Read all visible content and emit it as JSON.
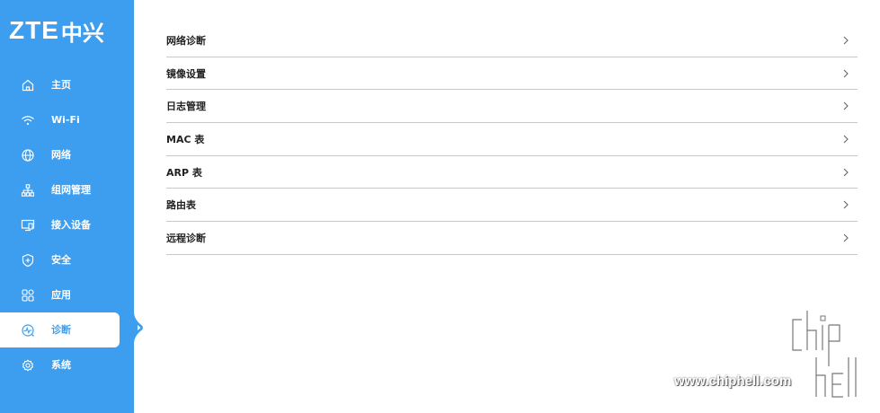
{
  "brand": {
    "latin": "ZTE",
    "cjk": "中兴"
  },
  "sidebar": {
    "items": [
      {
        "label": "主页",
        "icon": "home-icon"
      },
      {
        "label": "Wi-Fi",
        "icon": "wifi-icon"
      },
      {
        "label": "网络",
        "icon": "globe-icon"
      },
      {
        "label": "组网管理",
        "icon": "network-topology-icon"
      },
      {
        "label": "接入设备",
        "icon": "monitor-icon"
      },
      {
        "label": "安全",
        "icon": "shield-icon"
      },
      {
        "label": "应用",
        "icon": "apps-grid-icon"
      },
      {
        "label": "诊断",
        "icon": "diagnose-icon",
        "active": true
      },
      {
        "label": "系统",
        "icon": "gear-icon"
      }
    ]
  },
  "menu": {
    "items": [
      {
        "label": "网络诊断"
      },
      {
        "label": "镜像设置"
      },
      {
        "label": "日志管理"
      },
      {
        "label": "MAC 表"
      },
      {
        "label": "ARP 表"
      },
      {
        "label": "路由表"
      },
      {
        "label": "远程诊断"
      }
    ]
  },
  "watermark": {
    "url": "www.chiphell.com",
    "logo": "chiphell-logo"
  },
  "colors": {
    "sidebar": "#3d9ef0",
    "active_text": "#3d9ef0",
    "divider": "#c8c8c8"
  }
}
